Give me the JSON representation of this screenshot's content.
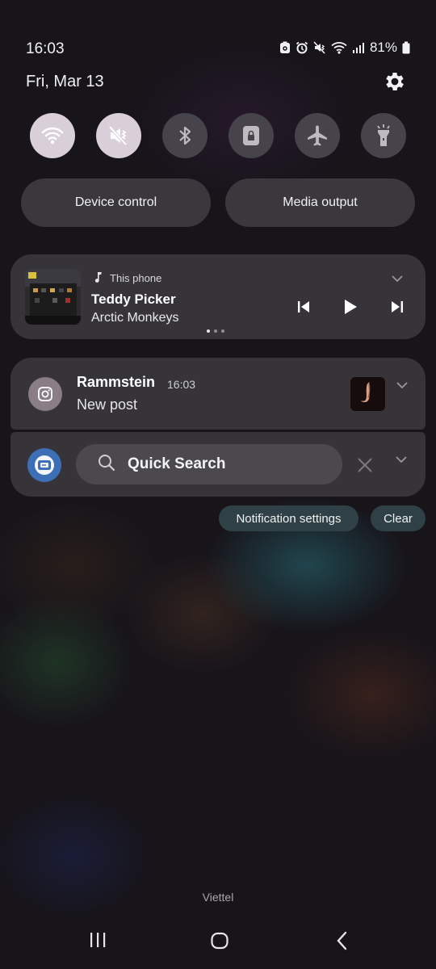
{
  "status_bar": {
    "time": "16:03",
    "battery": "81%"
  },
  "header": {
    "date": "Fri, Mar 13"
  },
  "quick_toggles": [
    {
      "name": "wifi",
      "state": "on"
    },
    {
      "name": "sound-mute",
      "state": "on"
    },
    {
      "name": "bluetooth",
      "state": "off"
    },
    {
      "name": "portrait-lock",
      "state": "off"
    },
    {
      "name": "airplane",
      "state": "off"
    },
    {
      "name": "flashlight",
      "state": "off"
    }
  ],
  "buttons": {
    "device_control": "Device control",
    "media_output": "Media output"
  },
  "media": {
    "source": "This phone",
    "title": "Teddy Picker",
    "artist": "Arctic Monkeys",
    "page_index": 0,
    "page_count": 3
  },
  "notification": {
    "app": "Rammstein",
    "time": "16:03",
    "text": "New post",
    "icon": "instagram-icon"
  },
  "quick_search": {
    "label": "Quick Search"
  },
  "actions": {
    "notification_settings": "Notification settings",
    "clear": "Clear"
  },
  "footer": {
    "carrier": "Viettel"
  },
  "colors": {
    "toggle_on": "#d9cfd8",
    "toggle_off": "#46444a",
    "card": "#363438",
    "chip": "#2f4147",
    "quick_search_accent": "#3c6fb5"
  }
}
